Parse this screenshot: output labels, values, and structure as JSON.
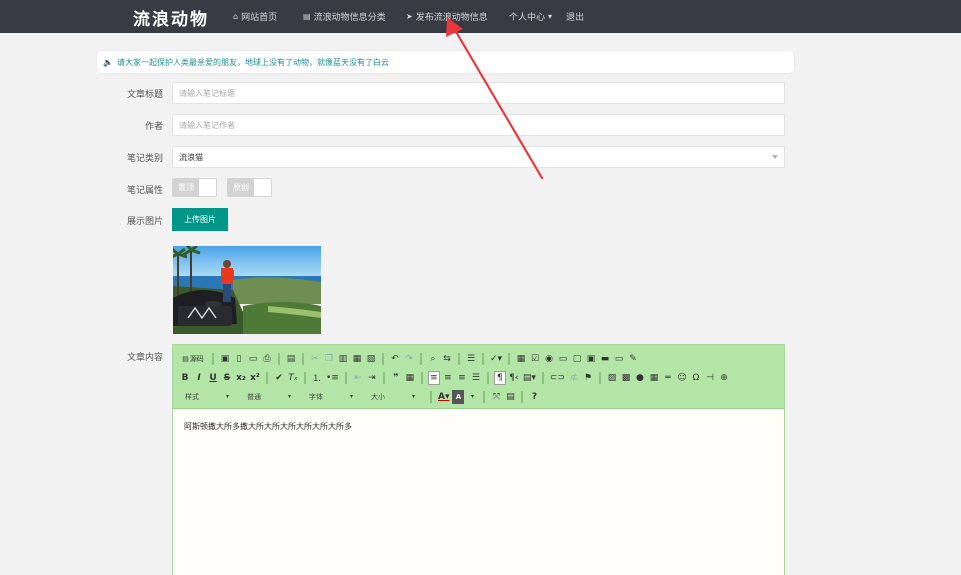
{
  "nav": {
    "logo": "流浪动物",
    "items": [
      {
        "label": "网站首页",
        "icon": "home-icon",
        "glyph": "⌂"
      },
      {
        "label": "流浪动物信息分类",
        "icon": "document-icon",
        "glyph": "▤"
      },
      {
        "label": "发布流浪动物信息",
        "icon": "send-icon",
        "glyph": "➤"
      },
      {
        "label": "个人中心",
        "icon": "caret-down-icon",
        "glyph": "▾"
      },
      {
        "label": "退出"
      }
    ]
  },
  "notice": {
    "icon": "speaker-icon",
    "text": "请大家一起保护人类最亲爱的朋友，地球上没有了动物，就像蓝天没有了白云"
  },
  "form": {
    "title_label": "文章标题",
    "title_placeholder": "请输入笔记标题",
    "author_label": "作者",
    "author_placeholder": "请输入笔记作者",
    "category_label": "笔记类别",
    "category_value": "流浪猫",
    "attr_label": "笔记属性",
    "attr_options": [
      "置顶",
      "原创"
    ],
    "image_label": "展示图片",
    "upload_label": "上传图片",
    "content_label": "文章内容"
  },
  "editor": {
    "source_label": "源码",
    "dropdowns": [
      "样式",
      "普通",
      "字体",
      "大小"
    ],
    "content": "阿斯顿撒大所多撒大所大所大所大所大所大所多"
  },
  "colors": {
    "nav_bg": "#383b44",
    "accent": "#009688",
    "toolbar_bg": "#b3e6a6",
    "annotation": "#e8383d"
  }
}
